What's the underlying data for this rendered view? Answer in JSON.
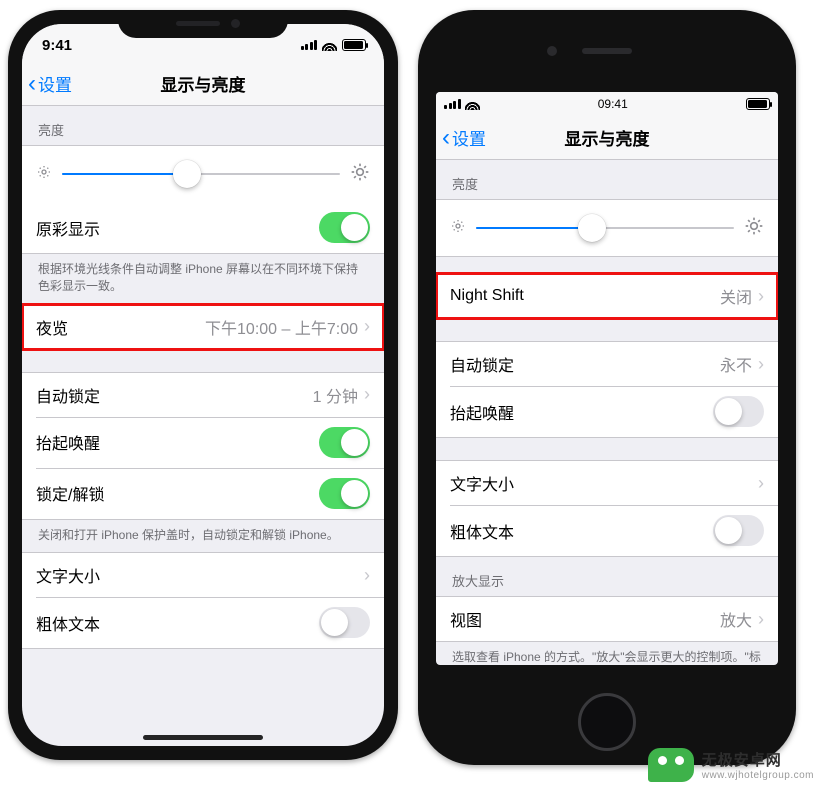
{
  "phone_left": {
    "status": {
      "time": "9:41"
    },
    "nav": {
      "back": "设置",
      "title": "显示与亮度"
    },
    "brightness": {
      "header": "亮度",
      "value_pct": 45
    },
    "true_tone": {
      "label": "原彩显示",
      "on": true
    },
    "true_tone_footer": "根据环境光线条件自动调整 iPhone 屏幕以在不同环境下保持色彩显示一致。",
    "night_shift": {
      "label": "夜览",
      "detail": "下午10:00 – 上午7:00"
    },
    "auto_lock": {
      "label": "自动锁定",
      "detail": "1 分钟"
    },
    "raise_to_wake": {
      "label": "抬起唤醒",
      "on": true
    },
    "lock_unlock": {
      "label": "锁定/解锁",
      "on": true
    },
    "lock_footer": "关闭和打开 iPhone 保护盖时，自动锁定和解锁 iPhone。",
    "text_size": {
      "label": "文字大小"
    },
    "bold_text": {
      "label": "粗体文本",
      "on": false
    }
  },
  "phone_right": {
    "status": {
      "time": "09:41"
    },
    "nav": {
      "back": "设置",
      "title": "显示与亮度"
    },
    "brightness": {
      "header": "亮度",
      "value_pct": 45
    },
    "night_shift": {
      "label": "Night Shift",
      "detail": "关闭"
    },
    "auto_lock": {
      "label": "自动锁定",
      "detail": "永不"
    },
    "raise_to_wake": {
      "label": "抬起唤醒",
      "on": false
    },
    "text_size": {
      "label": "文字大小"
    },
    "bold_text": {
      "label": "粗体文本",
      "on": false
    },
    "zoom": {
      "header": "放大显示",
      "label": "视图",
      "detail": "放大",
      "footer": "选取查看 iPhone 的方式。\"放大\"会显示更大的控制项。\"标准\"会显示更多的内容。"
    }
  },
  "watermark": {
    "name": "无极安卓网",
    "url": "www.wjhotelgroup.com"
  }
}
